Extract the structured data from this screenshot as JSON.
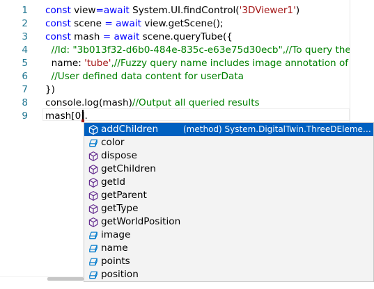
{
  "editor": {
    "lines": [
      {
        "num": "1",
        "tokens": [
          [
            "kw",
            "const "
          ],
          [
            "tx",
            "view"
          ],
          [
            "kw",
            "=await "
          ],
          [
            "tx",
            "System.UI.findControl("
          ],
          [
            "str",
            "'3DViewer1'"
          ],
          [
            "tx",
            ")"
          ]
        ]
      },
      {
        "num": "2",
        "tokens": [
          [
            "kw",
            "const "
          ],
          [
            "tx",
            "scene "
          ],
          [
            "kw",
            "= await "
          ],
          [
            "tx",
            "view.getScene();"
          ]
        ]
      },
      {
        "num": "3",
        "tokens": [
          [
            "kw",
            "const "
          ],
          [
            "tx",
            "mash "
          ],
          [
            "kw",
            "= await "
          ],
          [
            "tx",
            "scene.queryTube({"
          ]
        ]
      },
      {
        "num": "4",
        "tokens": [
          [
            "cmt",
            "  //Id: \"3b013f32-d6b0-484e-835c-e63e75d30ecb\",//To query the un"
          ]
        ]
      },
      {
        "num": "5",
        "tokens": [
          [
            "tx",
            "  name: "
          ],
          [
            "str",
            "'tube'"
          ],
          [
            "cmt",
            ",//Fuzzy query name includes image annotation of the"
          ]
        ]
      },
      {
        "num": "6",
        "tokens": [
          [
            "cmt",
            "  //User defined data content for userData"
          ]
        ]
      },
      {
        "num": "7",
        "tokens": [
          [
            "tx",
            "})"
          ]
        ]
      },
      {
        "num": "8",
        "tokens": [
          [
            "tx",
            "console.log(mash)"
          ],
          [
            "cmt",
            "//Output all queried results"
          ]
        ]
      },
      {
        "num": "9",
        "tokens": [
          [
            "tx",
            "mash[0]."
          ]
        ]
      }
    ]
  },
  "suggest": {
    "items": [
      {
        "label": "addChildren",
        "kind": "method",
        "detail": "(method) System.DigitalTwin.ThreeDElement.a…",
        "selected": true
      },
      {
        "label": "color",
        "kind": "property"
      },
      {
        "label": "dispose",
        "kind": "method"
      },
      {
        "label": "getChildren",
        "kind": "method"
      },
      {
        "label": "getId",
        "kind": "method"
      },
      {
        "label": "getParent",
        "kind": "method"
      },
      {
        "label": "getType",
        "kind": "method"
      },
      {
        "label": "getWorldPosition",
        "kind": "method"
      },
      {
        "label": "image",
        "kind": "property"
      },
      {
        "label": "name",
        "kind": "property"
      },
      {
        "label": "points",
        "kind": "property"
      },
      {
        "label": "position",
        "kind": "property"
      }
    ]
  },
  "colors": {
    "keyword": "#0000ff",
    "string": "#a31515",
    "comment": "#008000",
    "line_number": "#237893",
    "selection": "#0060c0",
    "method_icon": "#652d90",
    "property_icon": "#007acc"
  }
}
